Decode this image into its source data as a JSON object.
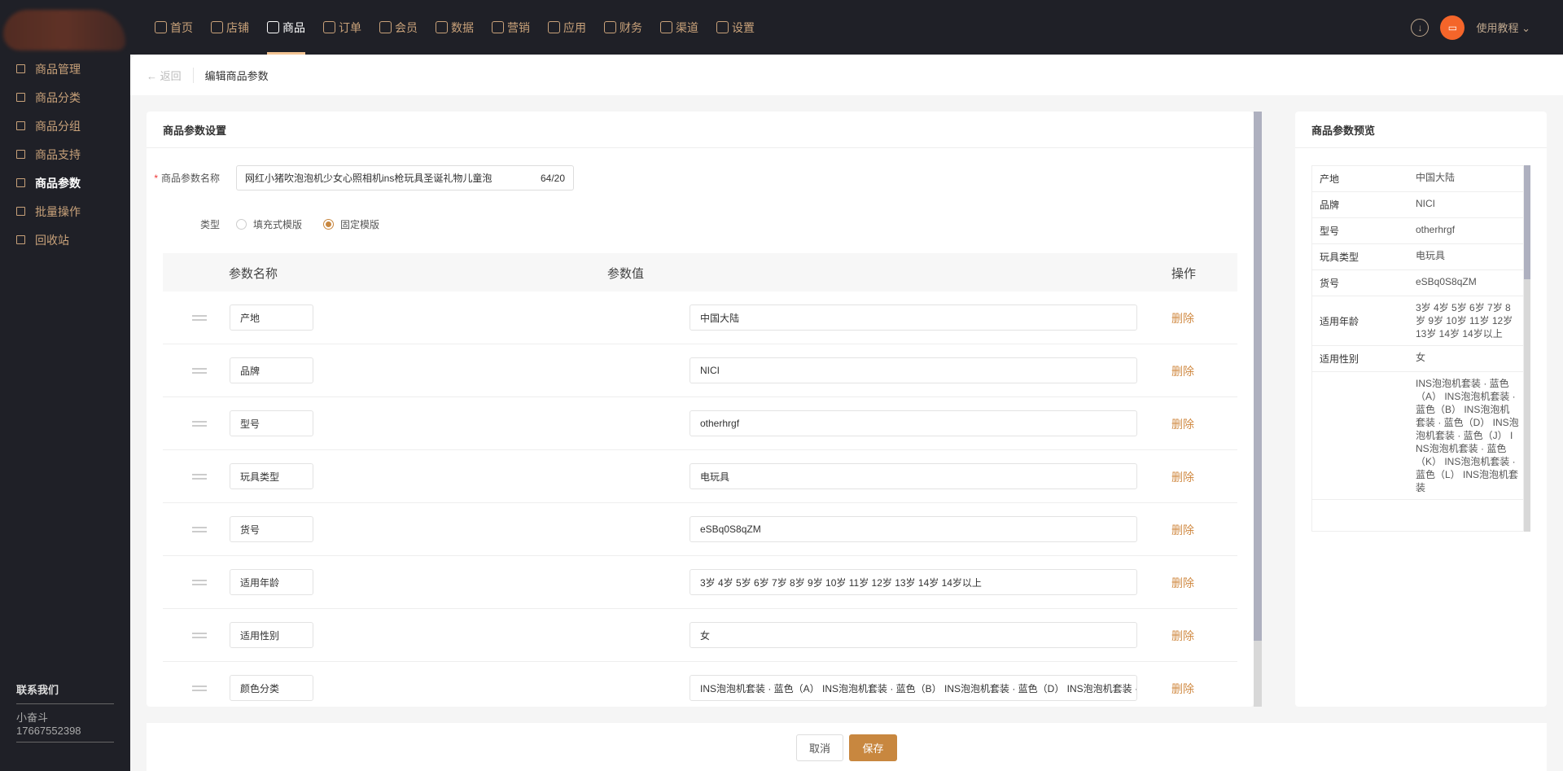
{
  "nav": [
    {
      "label": "首页",
      "icon": "home-icon"
    },
    {
      "label": "店铺",
      "icon": "shop-icon"
    },
    {
      "label": "商品",
      "icon": "product-icon",
      "active": true
    },
    {
      "label": "订单",
      "icon": "order-icon"
    },
    {
      "label": "会员",
      "icon": "user-icon"
    },
    {
      "label": "数据",
      "icon": "chart-icon"
    },
    {
      "label": "营销",
      "icon": "tag-icon"
    },
    {
      "label": "应用",
      "icon": "box-icon"
    },
    {
      "label": "财务",
      "icon": "finance-icon"
    },
    {
      "label": "渠道",
      "icon": "channel-icon"
    },
    {
      "label": "设置",
      "icon": "gear-icon"
    }
  ],
  "top": {
    "tutorial": "使用教程"
  },
  "sidebar": {
    "items": [
      {
        "label": "商品管理"
      },
      {
        "label": "商品分类"
      },
      {
        "label": "商品分组"
      },
      {
        "label": "商品支持"
      },
      {
        "label": "商品参数",
        "active": true
      },
      {
        "label": "批量操作"
      },
      {
        "label": "回收站"
      }
    ],
    "contact_title": "联系我们",
    "contact_name": "小奋斗",
    "contact_phone": "17667552398"
  },
  "breadcrumb": {
    "back": "返回",
    "title": "编辑商品参数"
  },
  "form": {
    "card_title": "商品参数设置",
    "name_label": "商品参数名称",
    "name_value": "网红小猪吹泡泡机少女心照相机ins枪玩具圣诞礼物儿童泡",
    "name_count": "64/20",
    "type_label": "类型",
    "type_options": [
      "填充式模版",
      "固定模版"
    ],
    "type_selected": "固定模版"
  },
  "table": {
    "headers": {
      "name": "参数名称",
      "value": "参数值",
      "action": "操作"
    },
    "delete_label": "删除",
    "rows": [
      {
        "name": "产地",
        "value": "中国大陆"
      },
      {
        "name": "品牌",
        "value": "NICI"
      },
      {
        "name": "型号",
        "value": "otherhrgf"
      },
      {
        "name": "玩具类型",
        "value": "电玩具"
      },
      {
        "name": "货号",
        "value": "eSBq0S8qZM"
      },
      {
        "name": "适用年龄",
        "value": "3岁 4岁 5岁 6岁 7岁 8岁 9岁 10岁 11岁 12岁 13岁 14岁 14岁以上"
      },
      {
        "name": "适用性别",
        "value": "女"
      },
      {
        "name": "颜色分类",
        "value": "INS泡泡机套装 · 蓝色（A） INS泡泡机套装 · 蓝色（B） INS泡泡机套装 · 蓝色（D） INS泡泡机套装 · 蓝色（J） INS泡泡机套装 · 蓝色（K） INS泡泡机套装 · 蓝色（L） INS泡泡机套装"
      }
    ]
  },
  "preview": {
    "title": "商品参数预览"
  },
  "footer": {
    "cancel": "取消",
    "save": "保存"
  },
  "colors": {
    "accent": "#c8873f",
    "topbar": "#1f2027",
    "delete": "#d08a43"
  }
}
